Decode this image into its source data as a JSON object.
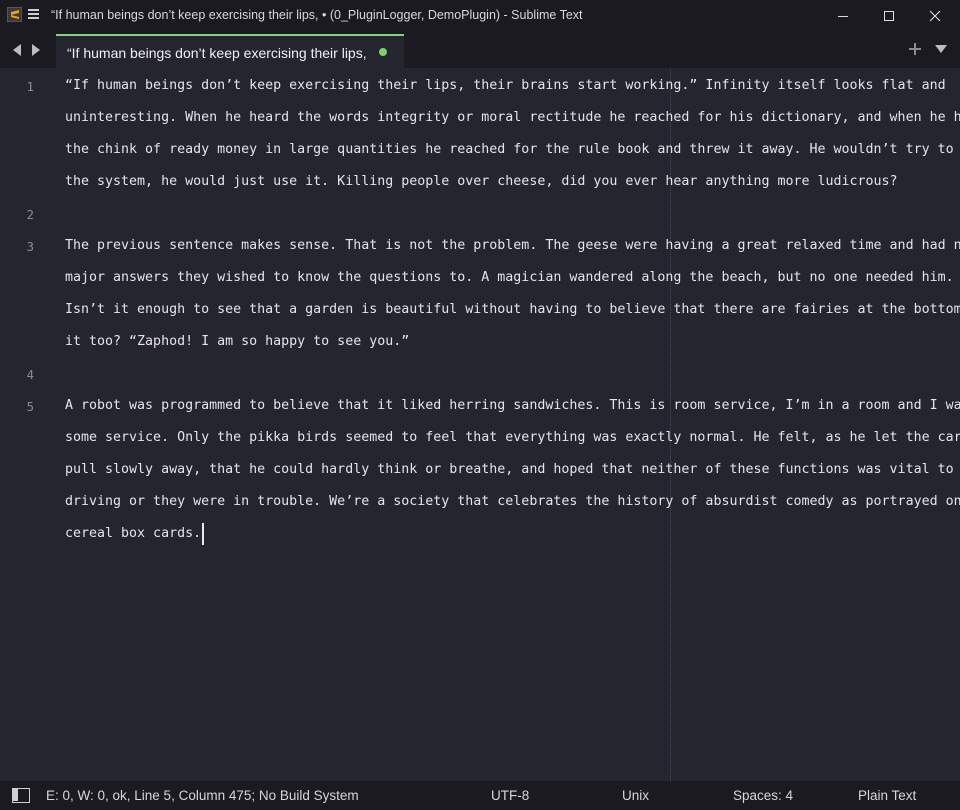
{
  "window": {
    "title": "“If human beings don’t keep exercising their lips, • (0_PluginLogger, DemoPlugin) - Sublime Text"
  },
  "tab": {
    "label": "“If human beings don’t keep exercising their lips,",
    "modified": true
  },
  "editor": {
    "lines": [
      {
        "number": "1",
        "rows": [
          "“If human beings don’t keep exercising their lips, their brains start working.” Infinity itself looks flat and",
          "uninteresting. When he heard the words integrity or moral rectitude he reached for his dictionary, and when he heard",
          "the chink of ready money in large quantities he reached for the rule book and threw it away. He wouldn’t try to beat",
          "the system, he would just use it. Killing people over cheese, did you ever hear anything more ludicrous?"
        ]
      },
      {
        "number": "2",
        "rows": [
          ""
        ]
      },
      {
        "number": "3",
        "rows": [
          "The previous sentence makes sense. That is not the problem. The geese were having a great relaxed time and had no",
          "major answers they wished to know the questions to. A magician wandered along the beach, but no one needed him.",
          "Isn’t it enough to see that a garden is beautiful without having to believe that there are fairies at the bottom of",
          "it too? “Zaphod! I am so happy to see you.”"
        ]
      },
      {
        "number": "4",
        "rows": [
          ""
        ]
      },
      {
        "number": "5",
        "rows": [
          "A robot was programmed to believe that it liked herring sandwiches. This is room service, I’m in a room and I want",
          "some service. Only the pikka birds seemed to feel that everything was exactly normal. He felt, as he let the car",
          "pull slowly away, that he could hardly think or breathe, and hoped that neither of these functions was vital to his",
          "driving or they were in trouble. We’re a society that celebrates the history of absurdist comedy as portrayed on",
          "cereal box cards."
        ]
      }
    ]
  },
  "status": {
    "info": "E: 0, W: 0, ok, Line 5, Column 475; No Build System",
    "encoding": "UTF-8",
    "line_endings": "Unix",
    "indentation": "Spaces: 4",
    "syntax": "Plain Text"
  },
  "icons": {
    "app": "sublime-text-icon",
    "menu": "hamburger-menu-icon",
    "minimize": "minimize-icon",
    "maximize": "maximize-icon",
    "close": "close-icon",
    "nav_back": "chevron-left-icon",
    "nav_forward": "chevron-right-icon",
    "new_tab": "plus-icon",
    "tab_list": "triangle-down-icon",
    "panel": "side-panel-icon"
  },
  "colors": {
    "background": "#25252f",
    "chrome": "#1a1a20",
    "tab_accent": "#80d37a",
    "modified_dot": "#7bd26b",
    "text": "#e4e4e8"
  }
}
